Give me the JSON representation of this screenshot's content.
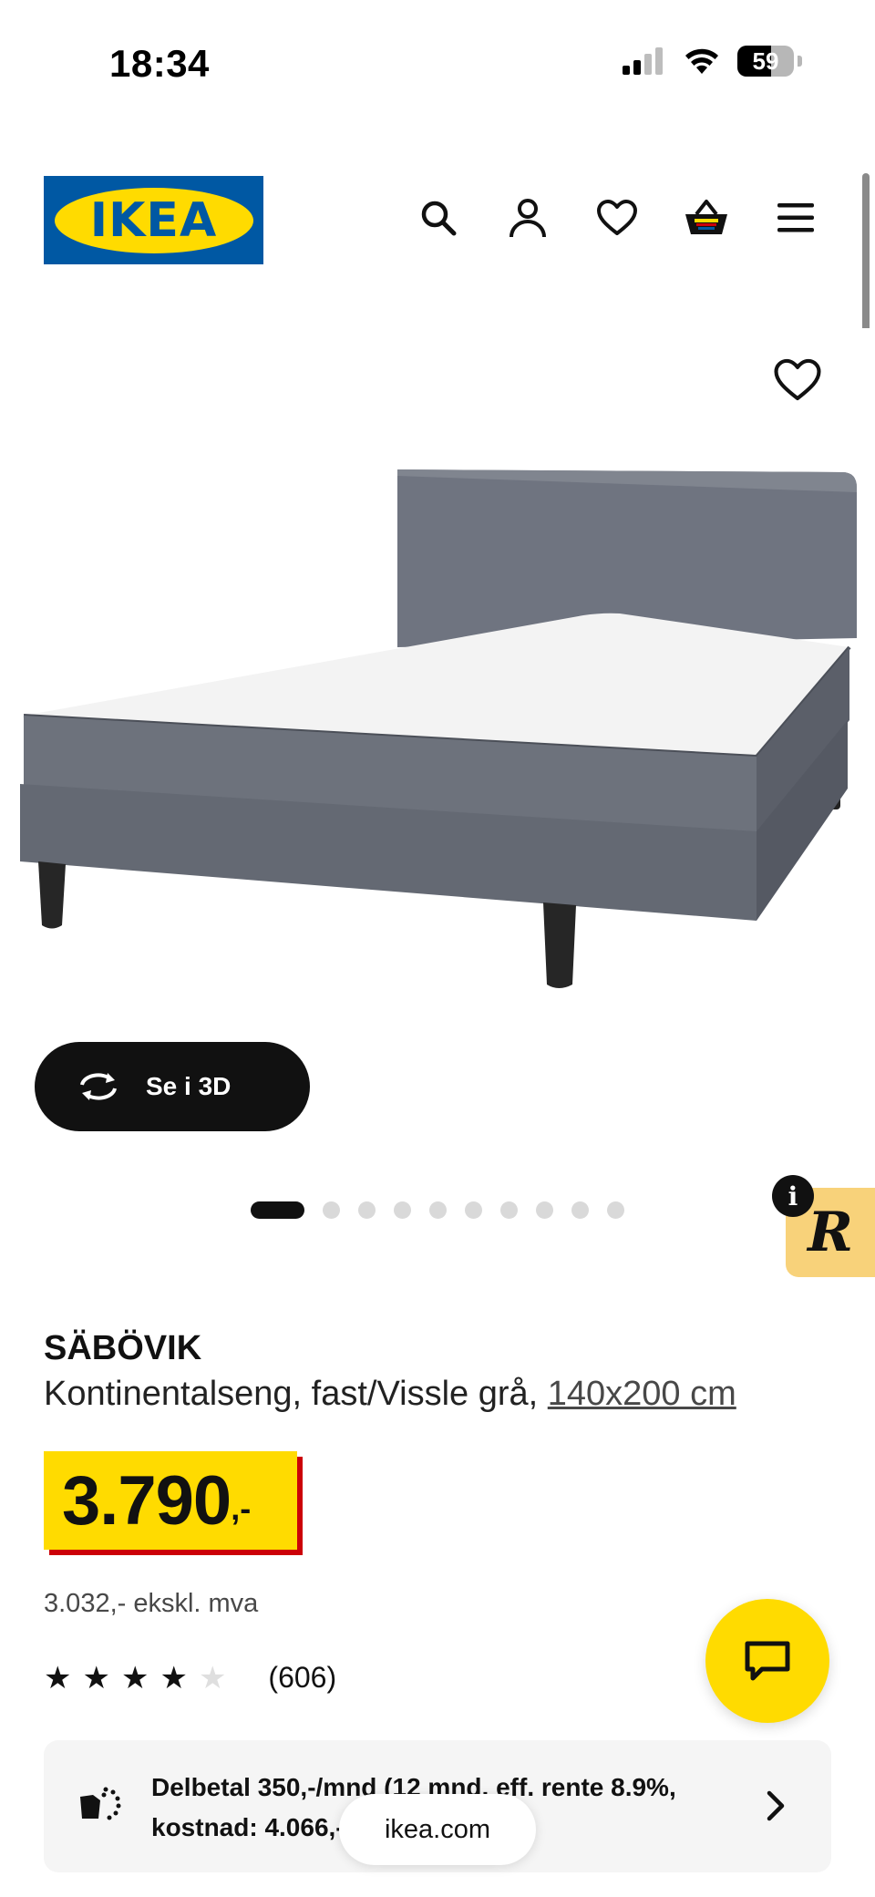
{
  "status_bar": {
    "time": "18:34",
    "battery": "59"
  },
  "header": {
    "logo_text": "IKEA",
    "icons": [
      "search-icon",
      "profile-icon",
      "heart-icon",
      "basket-icon",
      "menu-icon"
    ]
  },
  "gallery": {
    "view3d_label": "Se i 3D",
    "dot_count": 10,
    "active_dot": 0
  },
  "badge": {
    "letter": "R",
    "info": "i"
  },
  "product": {
    "name": "SÄBÖVIK",
    "description": "Kontinentalseng, fast/Vissle grå, ",
    "size": "140x200 cm",
    "price": "3.790",
    "price_suffix": ",-",
    "price_excl_vat": "3.032,- ekskl. mva",
    "rating": 4,
    "rating_max": 5,
    "rating_count": "(606)"
  },
  "installment": {
    "text": "Delbetal 350,-/mnd (12 mnd, eff. rente 8.9%, kostnad: 4.066,-)."
  },
  "browser": {
    "url": "ikea.com"
  },
  "colors": {
    "ikea_blue": "#0058a3",
    "ikea_yellow": "#ffdb00",
    "price_shadow_red": "#cc0008",
    "badge_yellow": "#f8d27a"
  }
}
